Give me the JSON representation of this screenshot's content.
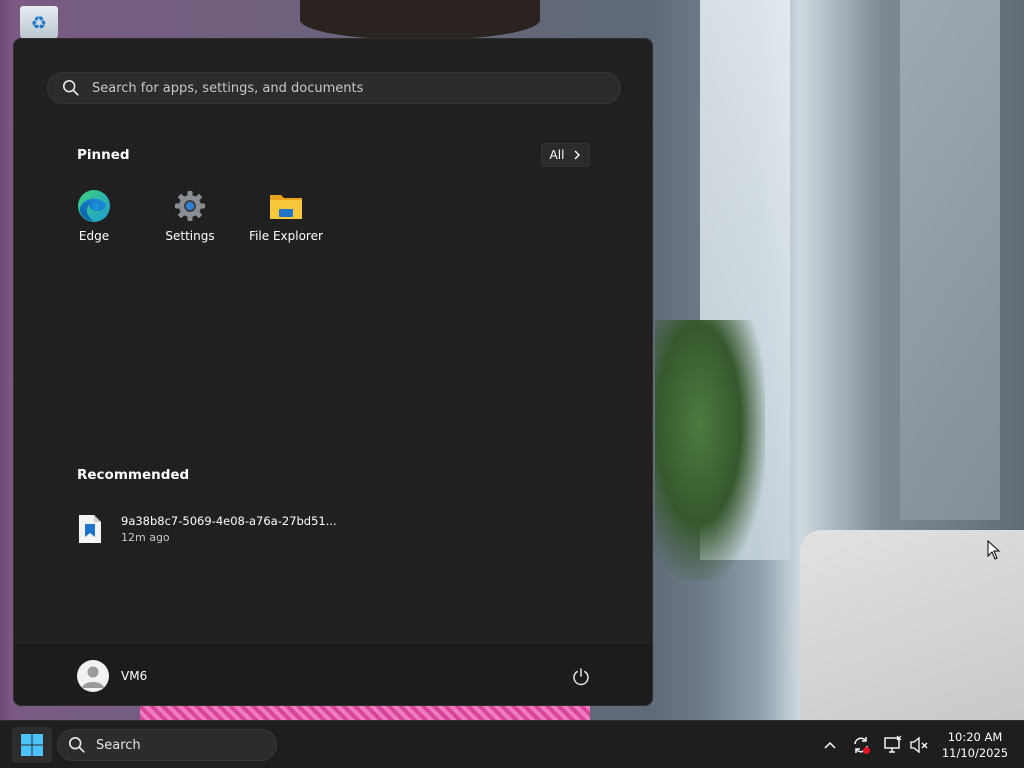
{
  "start_menu": {
    "search": {
      "placeholder": "Search for apps, settings, and documents"
    },
    "pinned": {
      "title": "Pinned",
      "all_label": "All",
      "apps": [
        {
          "label": "Edge",
          "icon": "edge-icon"
        },
        {
          "label": "Settings",
          "icon": "gear-icon"
        },
        {
          "label": "File Explorer",
          "icon": "folder-icon"
        }
      ]
    },
    "recommended": {
      "title": "Recommended",
      "items": [
        {
          "name": "9a38b8c7-5069-4e08-a76a-27bd51...",
          "time": "12m ago",
          "icon": "image-file-icon"
        }
      ]
    },
    "user": {
      "name": "VM6"
    }
  },
  "taskbar": {
    "search_label": "Search",
    "clock": {
      "time": "10:20 AM",
      "date": "11/10/2025"
    }
  },
  "colors": {
    "menu_bg": "#202020",
    "footer_bg": "#1c1c1c",
    "taskbar_bg": "#1e1e1e",
    "accent": "#0078d4"
  }
}
